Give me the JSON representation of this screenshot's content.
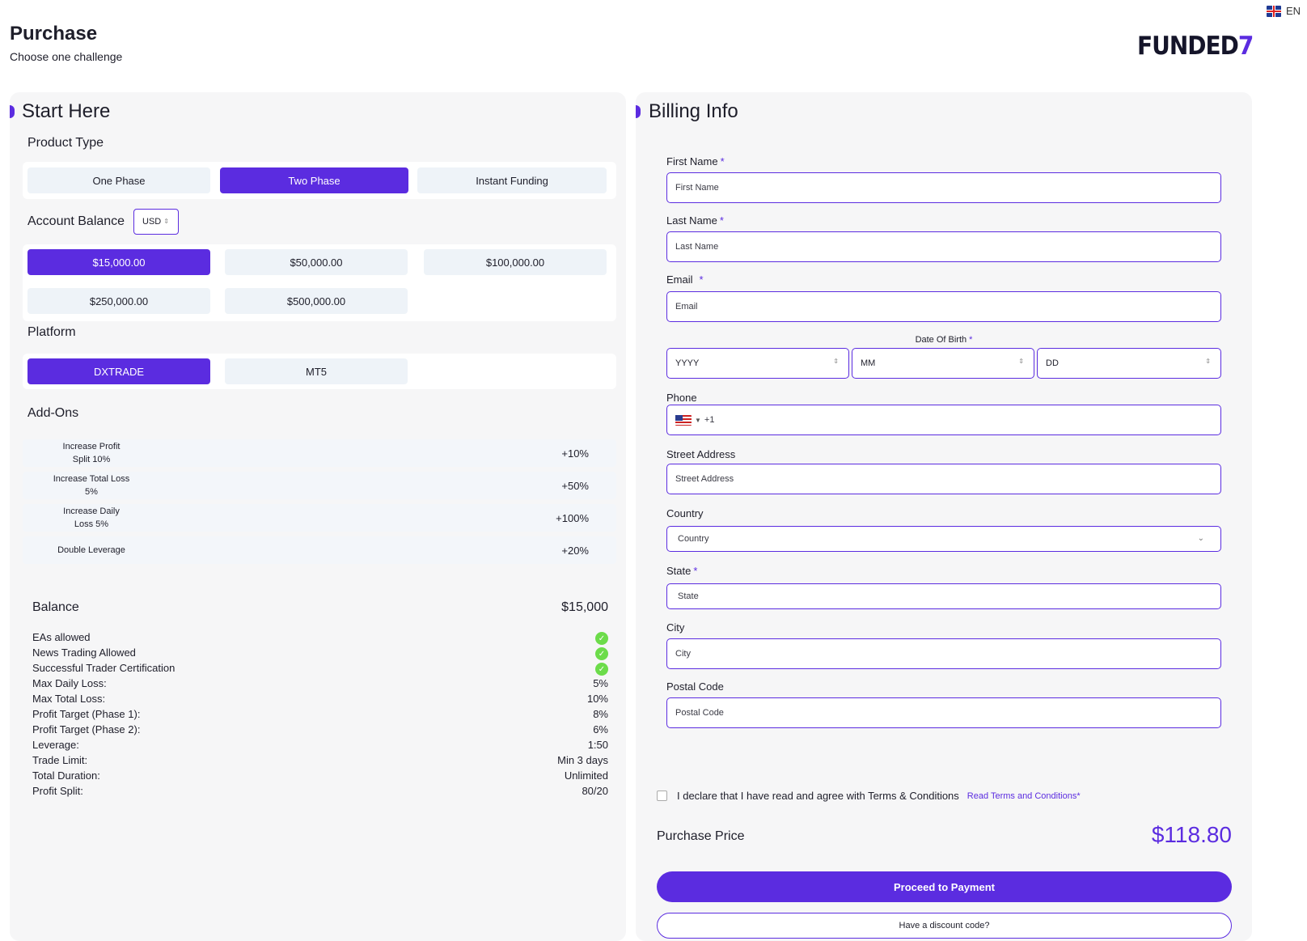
{
  "header": {
    "title": "Purchase",
    "subtitle": "Choose one challenge",
    "logo_text": "FUNDED",
    "logo_mark": "7",
    "language": "EN"
  },
  "start": {
    "title": "Start Here",
    "product_type_label": "Product Type",
    "product_types": [
      {
        "label": "One Phase",
        "active": false
      },
      {
        "label": "Two Phase",
        "active": true
      },
      {
        "label": "Instant Funding",
        "active": false
      }
    ],
    "account_balance_label": "Account Balance",
    "currency": "USD",
    "balances": [
      {
        "label": "$15,000.00",
        "active": true
      },
      {
        "label": "$50,000.00",
        "active": false
      },
      {
        "label": "$100,000.00",
        "active": false
      },
      {
        "label": "$250,000.00",
        "active": false
      },
      {
        "label": "$500,000.00",
        "active": false
      }
    ],
    "platform_label": "Platform",
    "platforms": [
      {
        "label": "DXTRADE",
        "active": true
      },
      {
        "label": "MT5",
        "active": false
      }
    ],
    "addons_label": "Add-Ons",
    "addons": [
      {
        "line1": "Increase Profit",
        "line2": "Split 10%",
        "value": "+10%"
      },
      {
        "line1": "Increase Total Loss",
        "line2": "5%",
        "value": "+50%"
      },
      {
        "line1": "Increase Daily",
        "line2": "Loss 5%",
        "value": "+100%"
      },
      {
        "line1": "Double Leverage",
        "line2": "",
        "value": "+20%"
      }
    ]
  },
  "summary": {
    "balance_label": "Balance",
    "balance_value": "$15,000",
    "features": [
      {
        "label": "EAs allowed"
      },
      {
        "label": "News Trading Allowed"
      },
      {
        "label": "Successful Trader Certification"
      }
    ],
    "specs": [
      {
        "label": "Max Daily Loss:",
        "value": "5%"
      },
      {
        "label": "Max Total Loss:",
        "value": "10%"
      },
      {
        "label": "Profit Target (Phase 1):",
        "value": "8%"
      },
      {
        "label": "Profit Target (Phase 2):",
        "value": "6%"
      },
      {
        "label": "Leverage:",
        "value": "1:50"
      },
      {
        "label": "Trade Limit:",
        "value": "Min 3 days"
      },
      {
        "label": "Total Duration:",
        "value": "Unlimited"
      },
      {
        "label": "Profit Split:",
        "value": "80/20"
      }
    ],
    "check_color": "#6cdc4a"
  },
  "billing": {
    "title": "Billing Info",
    "first_name_label": "First Name",
    "first_name_placeholder": "First Name",
    "last_name_label": "Last Name",
    "last_name_placeholder": "Last Name",
    "email_label": "Email",
    "email_placeholder": "Email",
    "dob_label": "Date Of Birth",
    "dob_year": "YYYY",
    "dob_month": "MM",
    "dob_day": "DD",
    "phone_label": "Phone",
    "phone_code": "+1",
    "street_label": "Street Address",
    "street_placeholder": "Street Address",
    "country_label": "Country",
    "country_value": "Country",
    "state_label": "State",
    "state_value": "State",
    "city_label": "City",
    "city_placeholder": "City",
    "postal_label": "Postal Code",
    "postal_placeholder": "Postal Code",
    "required_mark": "*",
    "agree_text": "I declare that I have read and agree with Terms & Conditions",
    "terms_link": "Read Terms and Conditions*",
    "price_label": "Purchase Price",
    "price_value": "$118.80",
    "pay_button": "Proceed to Payment",
    "discount_button": "Have a discount code?"
  },
  "colors": {
    "accent": "#5b2ce0",
    "panel_bg": "#f6f6f7",
    "option_bg": "#eef3f8"
  }
}
